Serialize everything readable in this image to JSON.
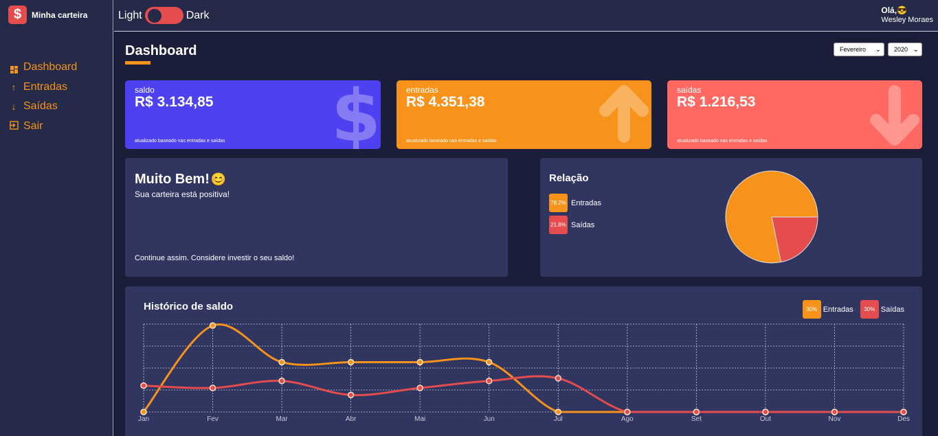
{
  "app": {
    "name": "Minha carteira",
    "logo_glyph": "$",
    "colors": {
      "bg": "#1b1e38",
      "panel": "#303660",
      "sidebar": "#252a48",
      "orange": "#f7931b",
      "red": "#e44c4e",
      "purple": "#4e41f0",
      "salmon": "#ff6961"
    }
  },
  "sidebar": {
    "items": [
      {
        "label": "Dashboard",
        "icon": "dashboard-grid-icon"
      },
      {
        "label": "Entradas",
        "icon": "arrow-up-icon"
      },
      {
        "label": "Saídas",
        "icon": "arrow-down-icon"
      },
      {
        "label": "Sair",
        "icon": "exit-icon"
      }
    ]
  },
  "topbar": {
    "theme_left": "Light",
    "theme_right": "Dark",
    "greeting": "Olá,😎",
    "user_name": "Wesley Moraes"
  },
  "header": {
    "title": "Dashboard",
    "month_select": "Fevereiro",
    "year_select": "2020"
  },
  "cards": [
    {
      "label": "saldo",
      "value": "R$ 3.134,85",
      "note": "atualizado baseado nas entradas e saídas",
      "color": "#4e41f0",
      "icon": "dollar-icon"
    },
    {
      "label": "entradas",
      "value": "R$ 4.351,38",
      "note": "atualizado baseado nas entradas e saídas",
      "color": "#f7931b",
      "icon": "arrow-up-icon"
    },
    {
      "label": "saídas",
      "value": "R$ 1.216,53",
      "note": "atualizado baseado nas entradas e saídas",
      "color": "#ff6961",
      "icon": "arrow-down-icon"
    }
  ],
  "message": {
    "title": "Muito Bem!",
    "emoji": "😊",
    "subtitle": "Sua carteira está positiva!",
    "footer": "Continue assim. Considere investir o seu saldo!"
  },
  "relation": {
    "title": "Relação",
    "legend": [
      {
        "percent": "78.2%",
        "label": "Entradas",
        "color": "#f7931b"
      },
      {
        "percent": "21.8%",
        "label": "Saídas",
        "color": "#e44c4e"
      }
    ]
  },
  "chart_data": [
    {
      "type": "pie",
      "title": "Relação",
      "series": [
        {
          "name": "Entradas",
          "value": 78.2,
          "color": "#f7931b"
        },
        {
          "name": "Saídas",
          "value": 21.8,
          "color": "#e44c4e"
        }
      ]
    },
    {
      "type": "line",
      "title": "Histórico de saldo",
      "legend": [
        {
          "percent": "30%",
          "label": "Entradas",
          "color": "#f7931b"
        },
        {
          "percent": "30%",
          "label": "Saídas",
          "color": "#e44c4e"
        }
      ],
      "categories": [
        "Jan",
        "Fev",
        "Mar",
        "Abr",
        "Mai",
        "Jun",
        "Jul",
        "Ago",
        "Set",
        "Out",
        "Nov",
        "Des"
      ],
      "ylim": [
        0,
        3000
      ],
      "grid": true,
      "series": [
        {
          "name": "Entradas",
          "color": "#f7931b",
          "values": [
            0,
            2950,
            1700,
            1700,
            1700,
            1700,
            0,
            0,
            0,
            0,
            0,
            0
          ]
        },
        {
          "name": "Saídas",
          "color": "#e44c4e",
          "values": [
            900,
            820,
            1060,
            580,
            820,
            1060,
            1150,
            0,
            0,
            0,
            0,
            0
          ]
        }
      ]
    }
  ]
}
